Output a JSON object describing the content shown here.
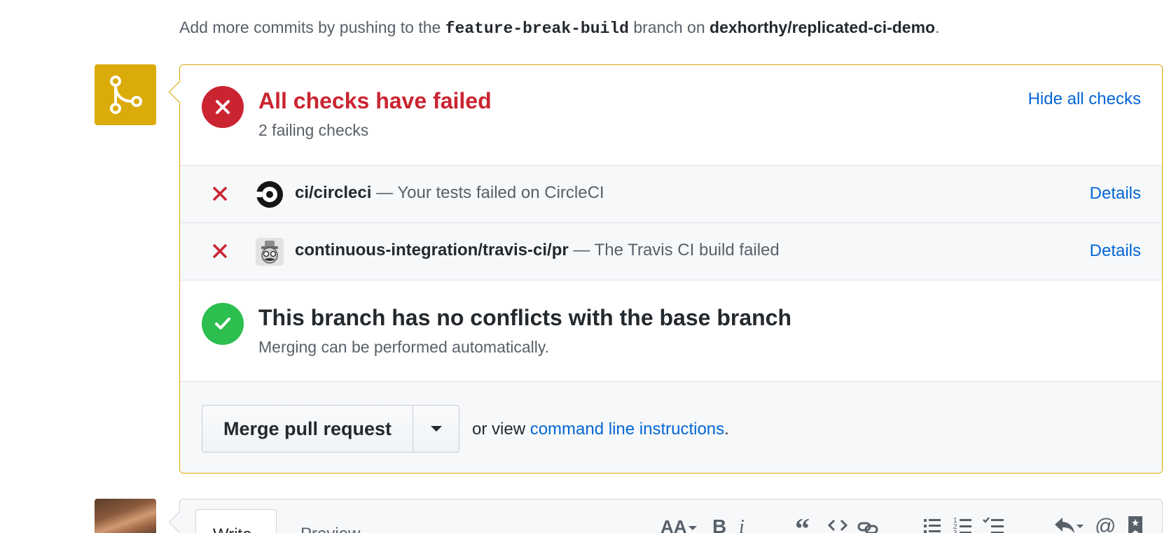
{
  "push_hint": {
    "prefix": "Add more commits by pushing to the",
    "branch": "feature-break-build",
    "middle": "branch on",
    "repo": "dexhorthy/replicated-ci-demo",
    "suffix": "."
  },
  "checks": {
    "title": "All checks have failed",
    "subtitle": "2 failing checks",
    "toggle_label": "Hide all checks",
    "items": [
      {
        "context": "ci/circleci",
        "description": "— Your tests failed on CircleCI",
        "details_label": "Details"
      },
      {
        "context": "continuous-integration/travis-ci/pr",
        "description": "— The Travis CI build failed",
        "details_label": "Details"
      }
    ]
  },
  "conflicts": {
    "title": "This branch has no conflicts with the base branch",
    "subtitle": "Merging can be performed automatically."
  },
  "merge": {
    "button_label": "Merge pull request",
    "alt_prefix": "or view",
    "alt_link": "command line instructions",
    "alt_suffix": "."
  },
  "comment": {
    "write_tab": "Write",
    "preview_tab": "Preview",
    "toolbar": [
      "header-icon",
      "bold-icon",
      "italic-icon",
      "quote-icon",
      "code-icon",
      "link-icon",
      "unordered-list-icon",
      "ordered-list-icon",
      "task-list-icon",
      "reply-icon",
      "mention-icon",
      "bookmark-icon"
    ]
  },
  "colors": {
    "failure": "#cb2431",
    "success": "#2cbe4e",
    "warning_border": "#dbab09",
    "link": "#0366d6"
  }
}
